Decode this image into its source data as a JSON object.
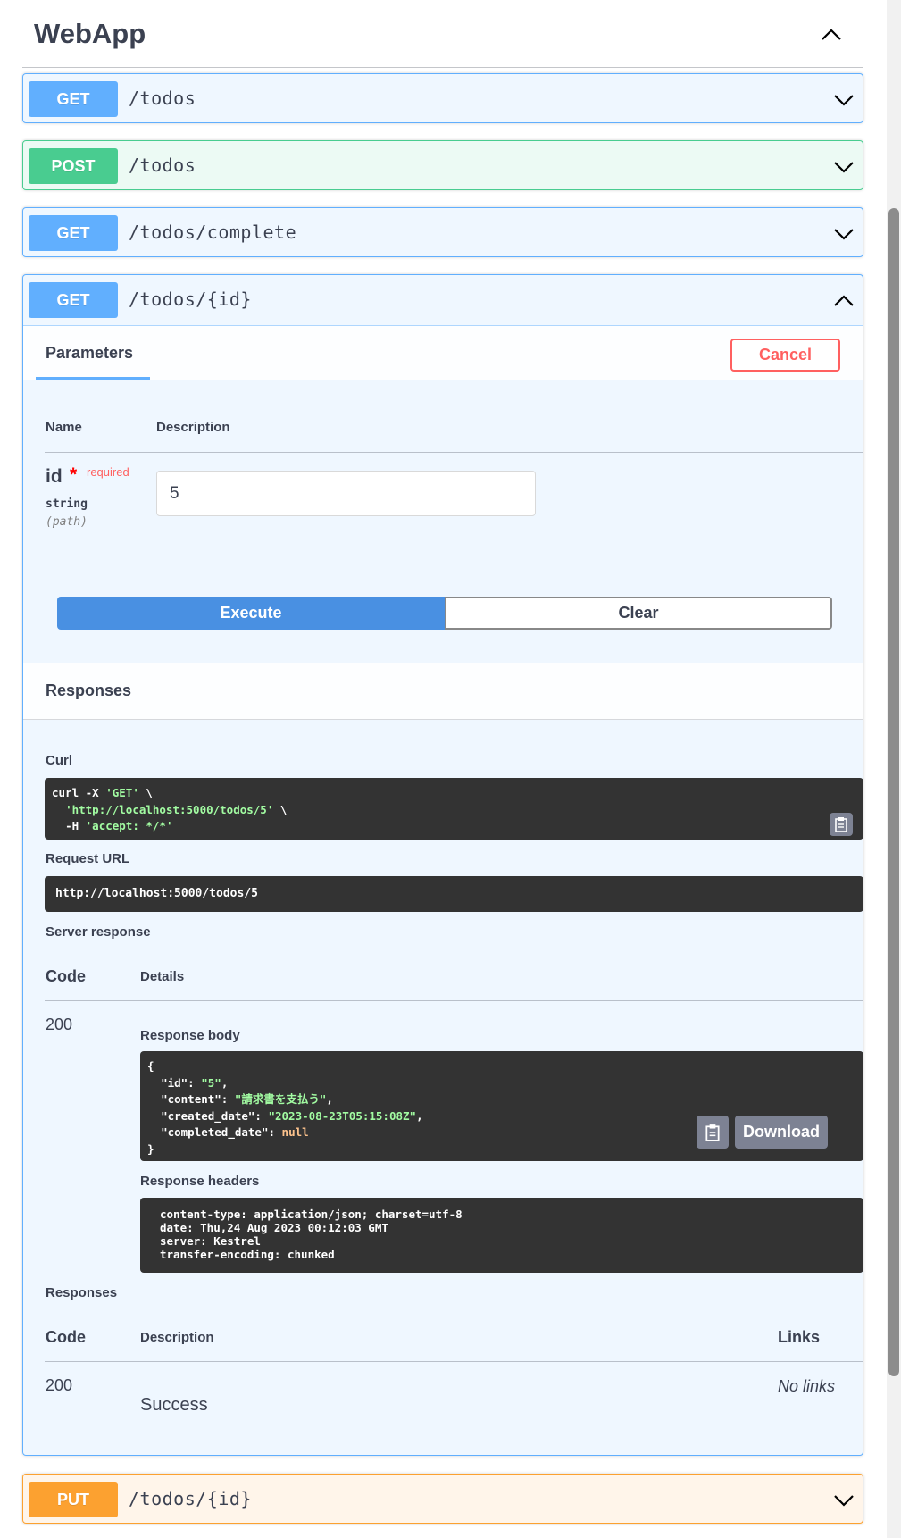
{
  "tag": {
    "title": "WebApp"
  },
  "operations": [
    {
      "method": "GET",
      "path": "/todos"
    },
    {
      "method": "POST",
      "path": "/todos"
    },
    {
      "method": "GET",
      "path": "/todos/complete"
    },
    {
      "method": "GET",
      "path": "/todos/{id}"
    },
    {
      "method": "PUT",
      "path": "/todos/{id}"
    }
  ],
  "expanded": {
    "parameters_tab": "Parameters",
    "cancel_label": "Cancel",
    "param_table": {
      "name_header": "Name",
      "description_header": "Description"
    },
    "param": {
      "name": "id",
      "required_star": "*",
      "required_label": "required",
      "type": "string",
      "location": "(path)",
      "value": "5"
    },
    "execute_label": "Execute",
    "clear_label": "Clear",
    "responses_heading": "Responses",
    "curl": {
      "label": "Curl",
      "line1_cmd": "curl -X ",
      "line1_str": "'GET'",
      "line1_tail": " \\",
      "line2_str": "'http://localhost:5000/todos/5'",
      "line2_tail": " \\",
      "line3_cmd": "-H ",
      "line3_str": "'accept: */*'"
    },
    "request_url": {
      "label": "Request URL",
      "value": "http://localhost:5000/todos/5"
    },
    "server_response": {
      "label": "Server response",
      "code_header": "Code",
      "details_header": "Details",
      "code": "200",
      "body_label": "Response body",
      "body": {
        "open": "{",
        "k_id": "\"id\"",
        "v_id": "\"5\"",
        "k_content": "\"content\"",
        "v_content": "\"請求書を支払う\"",
        "k_created": "\"created_date\"",
        "v_created": "\"2023-08-23T05:15:08Z\"",
        "k_completed": "\"completed_date\"",
        "v_completed": "null",
        "close": "}"
      },
      "download_label": "Download",
      "headers_label": "Response headers",
      "headers": [
        "content-type: application/json; charset=utf-8",
        "date: Thu,24 Aug 2023 00:12:03 GMT",
        "server: Kestrel",
        "transfer-encoding: chunked"
      ]
    },
    "responses": {
      "label": "Responses",
      "code_header": "Code",
      "description_header": "Description",
      "links_header": "Links",
      "code": "200",
      "description": "Success",
      "links": "No links"
    }
  },
  "colors": {
    "get": "#61affe",
    "post": "#49cc90",
    "put": "#fca130",
    "execute": "#4990e2",
    "cancel": "#ff6060"
  }
}
